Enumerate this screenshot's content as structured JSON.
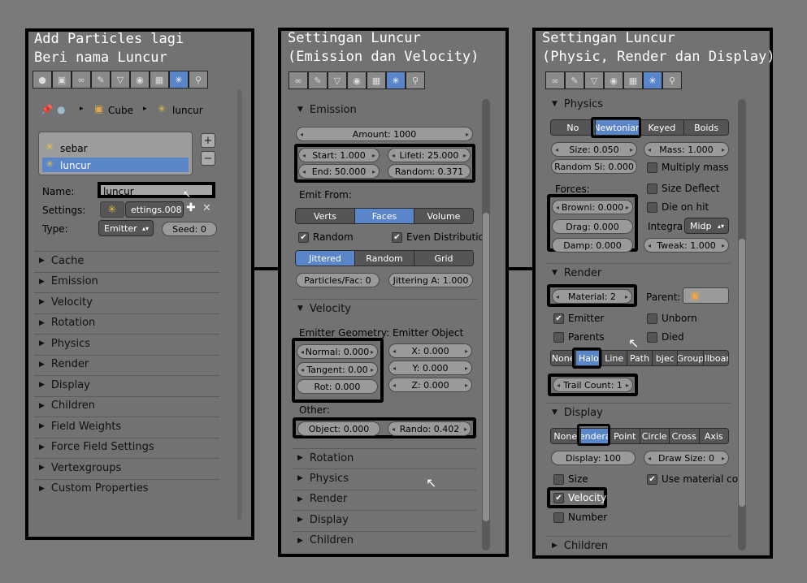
{
  "panel1": {
    "title1": "Add Particles lagi",
    "title2": "Beri nama Luncur",
    "breadcrumb_obj": "Cube",
    "breadcrumb_sys": "luncur",
    "systems": [
      "sebar",
      "luncur"
    ],
    "name_label": "Name:",
    "name_value": "luncur",
    "settings_label": "Settings:",
    "settings_value": "ettings.008",
    "type_label": "Type:",
    "type_value": "Emitter",
    "seed": "Seed: 0",
    "sections": [
      "Cache",
      "Emission",
      "Velocity",
      "Rotation",
      "Physics",
      "Render",
      "Display",
      "Children",
      "Field Weights",
      "Force Field Settings",
      "Vertexgroups",
      "Custom Properties"
    ]
  },
  "panel2": {
    "title1": "Settingan Luncur",
    "title2": "(Emission dan Velocity)",
    "emission": "Emission",
    "amount": "Amount: 1000",
    "start": "Start: 1.000",
    "lifetime": "Lifeti: 25.000",
    "end": "End: 50.000",
    "random": "Random: 0.371",
    "emit_from": "Emit From:",
    "emit_opts": [
      "Verts",
      "Faces",
      "Volume"
    ],
    "cb_random": "Random",
    "cb_even": "Even Distributio",
    "dist_opts": [
      "Jittered",
      "Random",
      "Grid"
    ],
    "particles_fac": "Particles/Fac: 0",
    "jittering": "Jittering A: 1.000",
    "velocity": "Velocity",
    "emitter_geometry": "Emitter Geometry:",
    "emitter_object": "Emitter Object",
    "normal": "Normal: 0.000",
    "tangent": "Tangent: 0.00",
    "rot": "Rot: 0.000",
    "x": "X: 0.000",
    "y": "Y: 0.000",
    "z": "Z: 0.000",
    "other": "Other:",
    "object": "Object: 0.000",
    "rando": "Rando: 0.402",
    "sections": [
      "Rotation",
      "Physics",
      "Render",
      "Display",
      "Children"
    ]
  },
  "panel3": {
    "title1": "Settingan Luncur",
    "title2": "(Physic, Render dan Display)",
    "physics": "Physics",
    "phys_opts": [
      "No",
      "Newtonian",
      "Keyed",
      "Boids"
    ],
    "size": "Size: 0.050",
    "mass": "Mass: 1.000",
    "random_size": "Random Si: 0.000",
    "multiply_mass": "Multiply mass",
    "forces": "Forces:",
    "size_deflect": "Size Deflect",
    "brownian": "Browni: 0.000",
    "die_on_hit": "Die on hit",
    "drag": "Drag: 0.000",
    "integration": "Integra",
    "integration_value": "Midp",
    "damp": "Damp: 0.000",
    "tweak": "Tweak: 1.000",
    "render": "Render",
    "material": "Material: 2",
    "parent": "Parent:",
    "emitter": "Emitter",
    "unborn": "Unborn",
    "parents": "Parents",
    "died": "Died",
    "render_opts": [
      "None",
      "Halo",
      "Line",
      "Path",
      "bjec",
      "Group",
      "illboar"
    ],
    "trail_count": "Trail Count: 1",
    "display": "Display",
    "disp_opts": [
      "None",
      "endera",
      "Point",
      "Circle",
      "Cross",
      "Axis"
    ],
    "display_val": "Display: 100",
    "draw_size": "Draw Size: 0",
    "disp_size": "Size",
    "use_material": "Use material co",
    "velocity": "Velocity",
    "number": "Number",
    "children": "Children"
  }
}
